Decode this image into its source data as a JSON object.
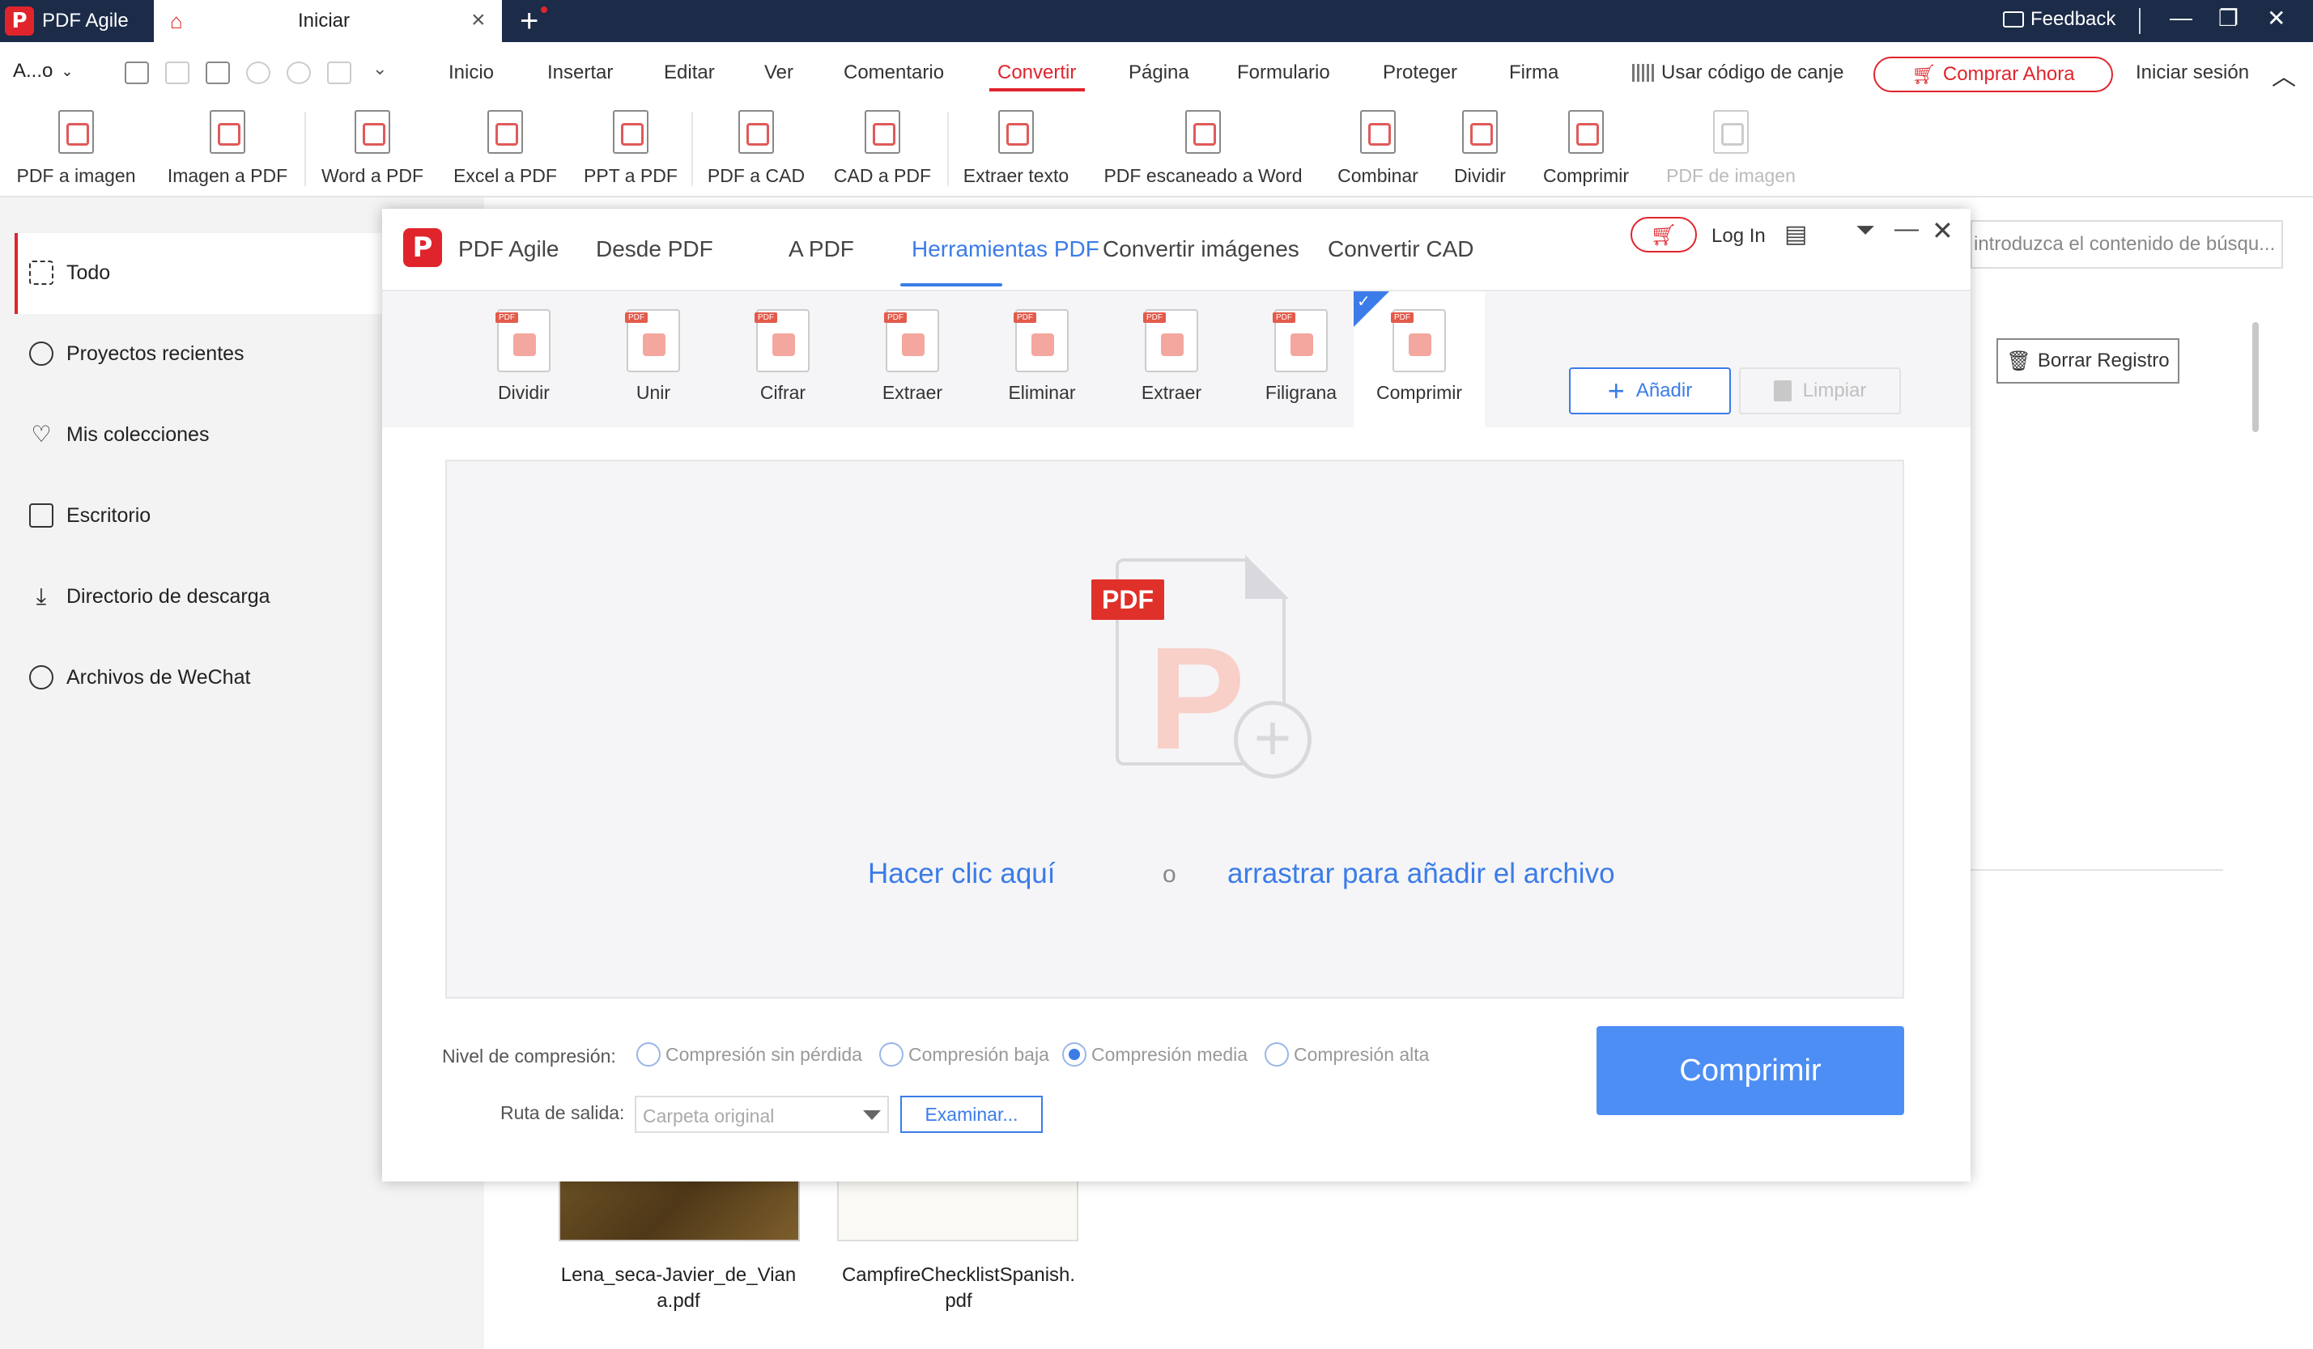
{
  "titlebar": {
    "app_name": "PDF Agile",
    "tab_title": "Iniciar",
    "feedback": "Feedback"
  },
  "menubar": {
    "account_short": "A...o",
    "items": [
      "Inicio",
      "Insertar",
      "Editar",
      "Ver",
      "Comentario",
      "Convertir",
      "Página",
      "Formulario",
      "Proteger",
      "Firma"
    ],
    "active": "Convertir",
    "canje": "Usar código de canje",
    "buy": "Comprar Ahora",
    "login": "Iniciar sesión"
  },
  "ribbon": {
    "items": [
      "PDF a imagen",
      "Imagen a PDF",
      "Word a PDF",
      "Excel a PDF",
      "PPT a PDF",
      "PDF a CAD",
      "CAD a PDF",
      "Extraer texto",
      "PDF escaneado a Word",
      "Combinar",
      "Dividir",
      "Comprimir",
      "PDF de imagen"
    ],
    "disabled": [
      "PDF de imagen"
    ]
  },
  "sidebar": {
    "items": [
      "Todo",
      "Proyectos recientes",
      "Mis colecciones",
      "Escritorio",
      "Directorio de descarga",
      "Archivos de WeChat"
    ],
    "active": "Todo"
  },
  "main": {
    "search_placeholder": "introduzca el contenido de búsqu...",
    "clear_record": "Borrar Registro",
    "files": [
      {
        "name_line1": "Lena_seca-Javier_de_Vian",
        "name_line2": "a.pdf"
      },
      {
        "name_line1": "CampfireChecklistSpanish.",
        "name_line2": "pdf"
      }
    ]
  },
  "dialog": {
    "title": "PDF Agile",
    "tabs": [
      "Desde PDF",
      "A PDF",
      "Herramientas PDF",
      "Convertir imágenes",
      "Convertir CAD"
    ],
    "active_tab": "Herramientas PDF",
    "login": "Log In",
    "tools": [
      "Dividir",
      "Unir",
      "Cifrar",
      "Extraer",
      "Eliminar",
      "Extraer",
      "Filigrana",
      "Comprimir"
    ],
    "active_tool": "Comprimir",
    "add": "Añadir",
    "clear": "Limpiar",
    "drop": {
      "badge": "PDF",
      "click": "Hacer clic aquí",
      "or": "o",
      "drag": "arrastrar para añadir el archivo"
    },
    "compression_label": "Nivel de compresión:",
    "compression_options": [
      "Compresión sin pérdida",
      "Compresión baja",
      "Compresión media",
      "Compresión alta"
    ],
    "compression_selected": "Compresión media",
    "output_label": "Ruta de salida:",
    "output_value": "Carpeta original",
    "browse": "Examinar...",
    "compress": "Comprimir"
  },
  "colors": {
    "accent_red": "#e0242c",
    "accent_blue": "#3b7ce8",
    "titlebar": "#1b2b48"
  }
}
